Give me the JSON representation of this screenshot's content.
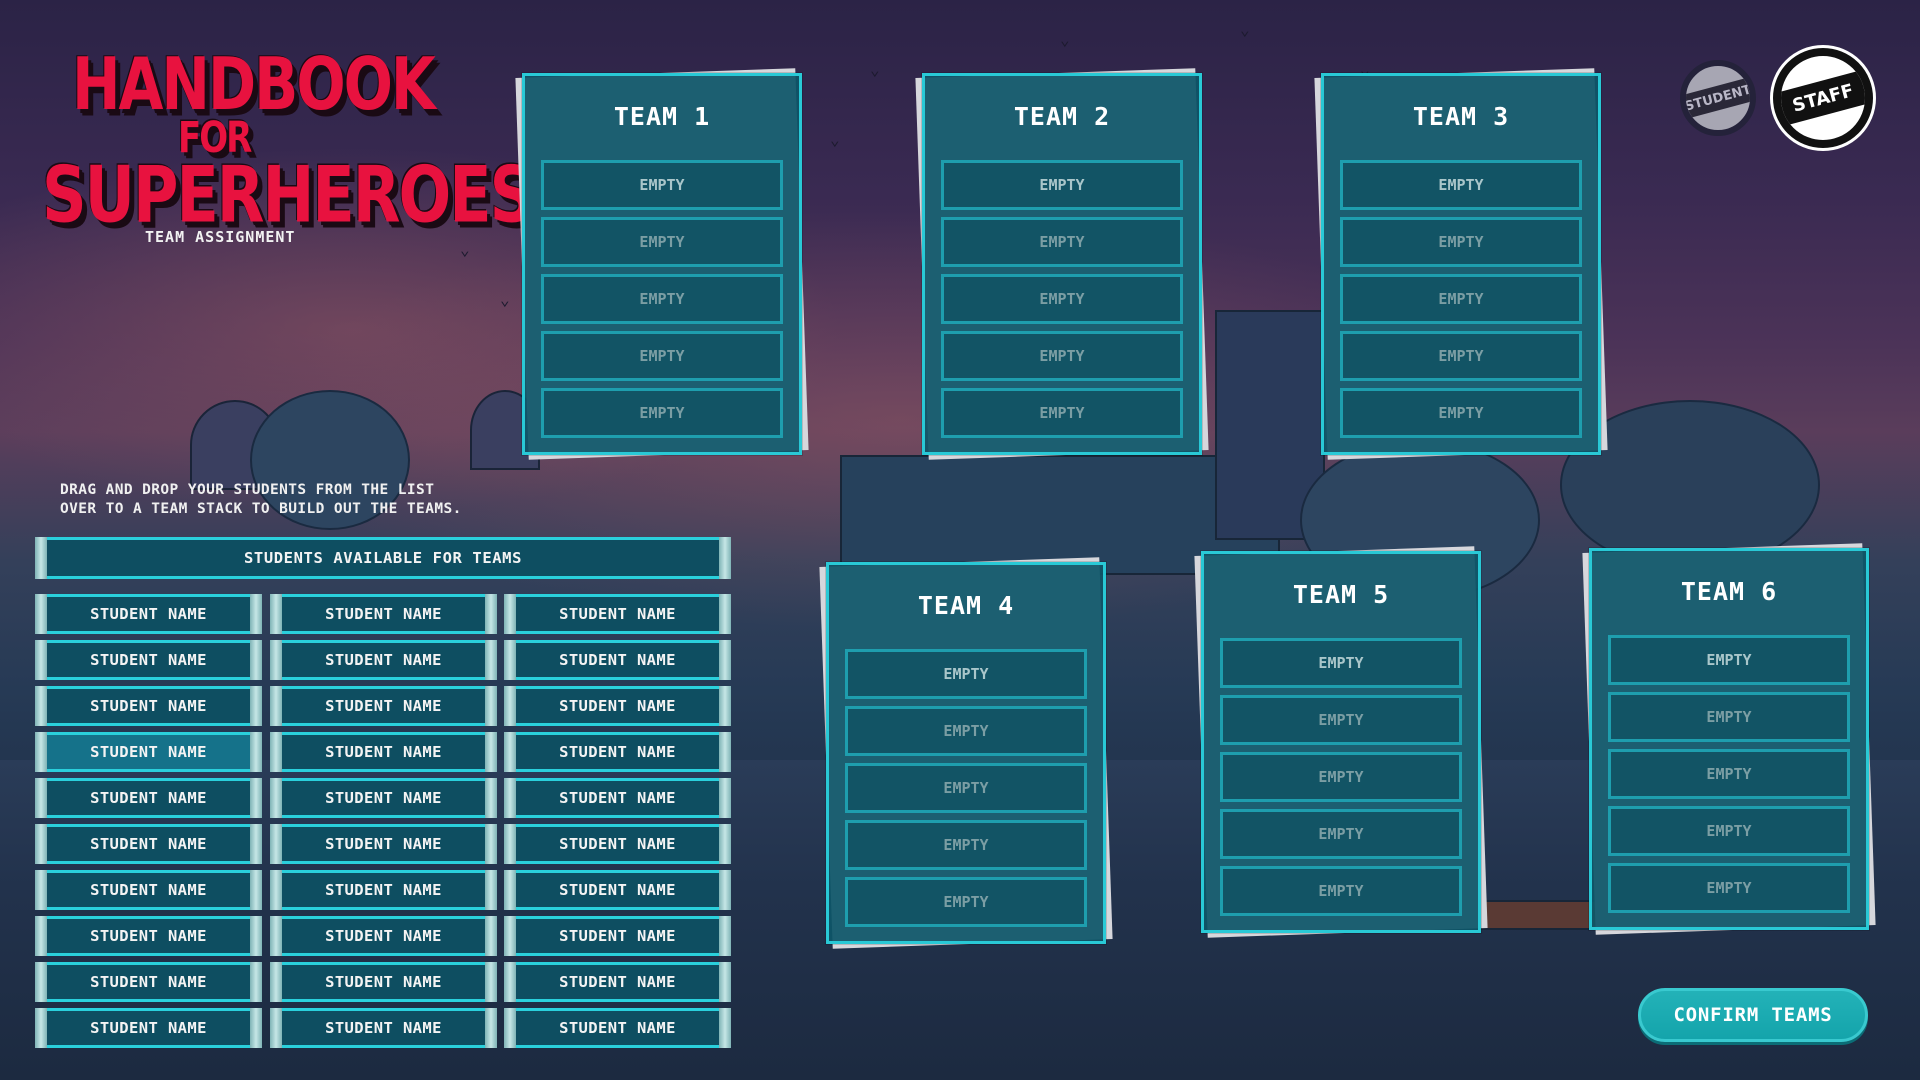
{
  "logo": {
    "line1": "HANDBOOK",
    "line2": "FOR",
    "line3": "SUPERHEROES",
    "subtitle": "TEAM ASSIGNMENT"
  },
  "role_toggle": {
    "student_label": "STUDENT",
    "staff_label": "STAFF",
    "active": "STAFF"
  },
  "teams": [
    {
      "title": "TEAM 1",
      "slots": [
        "EMPTY",
        "EMPTY",
        "EMPTY",
        "EMPTY",
        "EMPTY"
      ]
    },
    {
      "title": "TEAM 2",
      "slots": [
        "EMPTY",
        "EMPTY",
        "EMPTY",
        "EMPTY",
        "EMPTY"
      ]
    },
    {
      "title": "TEAM 3",
      "slots": [
        "EMPTY",
        "EMPTY",
        "EMPTY",
        "EMPTY",
        "EMPTY"
      ]
    },
    {
      "title": "TEAM 4",
      "slots": [
        "EMPTY",
        "EMPTY",
        "EMPTY",
        "EMPTY",
        "EMPTY"
      ]
    },
    {
      "title": "TEAM 5",
      "slots": [
        "EMPTY",
        "EMPTY",
        "EMPTY",
        "EMPTY",
        "EMPTY"
      ]
    },
    {
      "title": "TEAM 6",
      "slots": [
        "EMPTY",
        "EMPTY",
        "EMPTY",
        "EMPTY",
        "EMPTY"
      ]
    }
  ],
  "instructions": "DRAG AND DROP YOUR STUDENTS FROM THE LIST\nOVER TO A TEAM STACK TO BUILD OUT THE TEAMS.",
  "student_list": {
    "header": "STUDENTS AVAILABLE FOR TEAMS",
    "students": [
      "STUDENT NAME",
      "STUDENT NAME",
      "STUDENT NAME",
      "STUDENT NAME",
      "STUDENT NAME",
      "STUDENT NAME",
      "STUDENT NAME",
      "STUDENT NAME",
      "STUDENT NAME",
      "STUDENT NAME",
      "STUDENT NAME",
      "STUDENT NAME",
      "STUDENT NAME",
      "STUDENT NAME",
      "STUDENT NAME",
      "STUDENT NAME",
      "STUDENT NAME",
      "STUDENT NAME",
      "STUDENT NAME",
      "STUDENT NAME",
      "STUDENT NAME",
      "STUDENT NAME",
      "STUDENT NAME",
      "STUDENT NAME",
      "STUDENT NAME",
      "STUDENT NAME",
      "STUDENT NAME",
      "STUDENT NAME",
      "STUDENT NAME",
      "STUDENT NAME"
    ],
    "selected_index": 9
  },
  "confirm_label": "CONFIRM TEAMS",
  "colors": {
    "accent_cyan": "#29c9d6",
    "panel_teal": "#0e5668",
    "logo_red": "#e8123f",
    "button_teal": "#1aabb1"
  }
}
